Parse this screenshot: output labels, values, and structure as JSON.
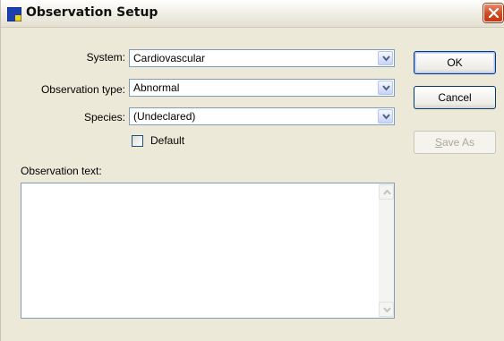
{
  "window": {
    "title": "Observation Setup"
  },
  "form": {
    "system": {
      "label": "System:",
      "value": "Cardiovascular"
    },
    "observation_type": {
      "label": "Observation type:",
      "value": "Abnormal"
    },
    "species": {
      "label": "Species:",
      "value": "(Undeclared)"
    },
    "default_checkbox": {
      "label": "Default",
      "checked": false
    },
    "observation_text": {
      "label": "Observation text:",
      "value": ""
    }
  },
  "buttons": {
    "ok": "OK",
    "cancel": "Cancel",
    "save_as_mnemonic": "S",
    "save_as_rest": "ave As"
  },
  "colors": {
    "window_bg": "#ece9d8",
    "border": "#7f9db9",
    "close_red": "#d2471f"
  }
}
